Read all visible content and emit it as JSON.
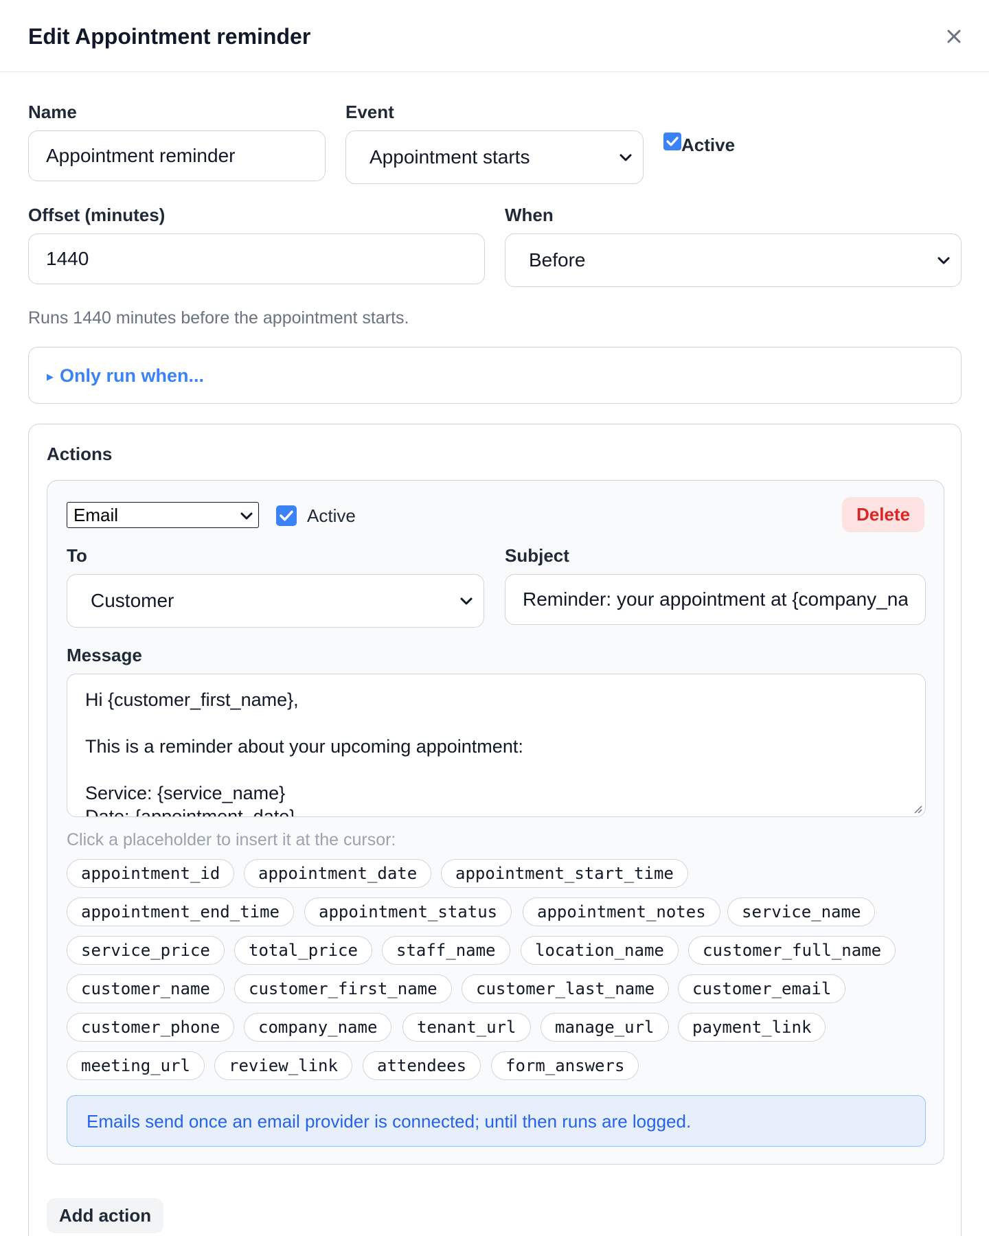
{
  "modal": {
    "title": "Edit Appointment reminder"
  },
  "form": {
    "name_label": "Name",
    "name_value": "Appointment reminder",
    "event_label": "Event",
    "event_value": "Appointment starts",
    "active_label": "Active",
    "active_checked": true,
    "offset_label": "Offset (minutes)",
    "offset_value": "1440",
    "when_label": "When",
    "when_value": "Before",
    "hint": "Runs 1440 minutes before the appointment starts.",
    "only_run_label": "Only run when..."
  },
  "actions": {
    "title": "Actions",
    "add_label": "Add action",
    "items": [
      {
        "type_value": "Email",
        "active_label": "Active",
        "active_checked": true,
        "delete_label": "Delete",
        "to_label": "To",
        "to_value": "Customer",
        "subject_label": "Subject",
        "subject_value": "Reminder: your appointment at {company_name}",
        "message_label": "Message",
        "message_value": "Hi {customer_first_name},\n\nThis is a reminder about your upcoming appointment:\n\nService: {service_name}\nDate: {appointment_date}",
        "placeholder_hint": "Click a placeholder to insert it at the cursor:",
        "placeholders": [
          "appointment_id",
          "appointment_date",
          "appointment_start_time",
          "appointment_end_time",
          "appointment_status",
          "appointment_notes",
          "service_name",
          "service_price",
          "total_price",
          "staff_name",
          "location_name",
          "customer_full_name",
          "customer_name",
          "customer_first_name",
          "customer_last_name",
          "customer_email",
          "customer_phone",
          "company_name",
          "tenant_url",
          "manage_url",
          "payment_link",
          "meeting_url",
          "review_link",
          "attendees",
          "form_answers"
        ],
        "notice": "Emails send once an email provider is connected; until then runs are logged."
      }
    ]
  },
  "colors": {
    "accent": "#3b82f6",
    "danger": "#dc2626",
    "danger_bg": "#fde2e2",
    "notice_bg": "#e8effc",
    "notice_border": "#93c5fd"
  },
  "icons": {
    "close": "close-icon",
    "chevron": "chevron-down-icon",
    "check": "check-icon",
    "caret": "caret-right-icon",
    "resize": "resize-handle-icon"
  }
}
